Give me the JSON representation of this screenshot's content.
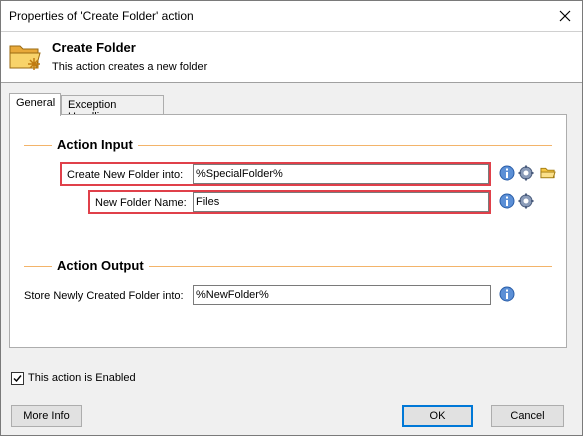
{
  "window": {
    "title": "Properties of 'Create Folder' action"
  },
  "header": {
    "title": "Create Folder",
    "description": "This action creates a new folder"
  },
  "tabs": [
    {
      "label": "General",
      "active": true
    },
    {
      "label": "Exception Handling",
      "active": false
    }
  ],
  "action_input": {
    "section_title": "Action Input",
    "create_into_label": "Create New Folder into:",
    "create_into_value": "%SpecialFolder%",
    "folder_name_label": "New Folder Name:",
    "folder_name_value": "Files"
  },
  "action_output": {
    "section_title": "Action Output",
    "store_label": "Store Newly Created Folder into:",
    "store_value": "%NewFolder%"
  },
  "enabled": {
    "label": "This action is Enabled",
    "checked": true
  },
  "buttons": {
    "more_info": "More Info",
    "ok": "OK",
    "cancel": "Cancel"
  },
  "colors": {
    "highlight": "#e0404a",
    "section_line": "#f3b46a",
    "default_button_border": "#0078d7",
    "folder_yellow": "#f5c542"
  },
  "icons": [
    "close-icon",
    "create-folder-icon",
    "info-icon",
    "gear-icon",
    "folder-icon",
    "checkmark-icon"
  ]
}
